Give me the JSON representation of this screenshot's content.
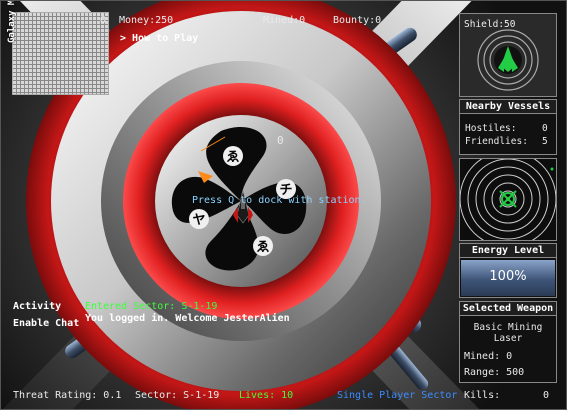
{
  "hud": {
    "galaxy_map_label": "Galaxy Map",
    "money": "Money:250",
    "mined": "Mined:0",
    "bounty": "Bounty:0",
    "how_to_play": "> How to Play",
    "dock_prompt": "Press Q to dock with station.",
    "speed_value": "0",
    "icon_o": "O",
    "activity": "Activity",
    "enable_chat": "Enable Chat",
    "chat_line1": "Entered Sector: S-1-19",
    "chat_line2": "You logged in. Welcome JesterAlien",
    "threat_rating": "Threat Rating: 0.1",
    "sector": "Sector: S-1-19",
    "lives": "Lives: 10",
    "mode": "Single Player Sector",
    "kills_label": "Kills:",
    "kills_value": "0"
  },
  "sidebar": {
    "shield": "Shield:50",
    "nearby_title": "Nearby Vessels",
    "hostiles_label": "Hostiles:",
    "hostiles_value": "0",
    "friendlies_label": "Friendlies:",
    "friendlies_value": "5",
    "energy_title": "Energy Level",
    "energy_value": "100%",
    "energy_fraction": 1.0,
    "weapon_title": "Selected Weapon",
    "weapon_name_line1": "Basic Mining",
    "weapon_name_line2": "Laser",
    "weapon_mined": "Mined: 0",
    "weapon_range": "Range: 500"
  },
  "colors": {
    "hud_green": "#3cff3c",
    "station_red": "#d01818",
    "mode_blue": "#3c8cff",
    "radar_green": "#22cc44"
  },
  "icons": {
    "station": "station-icon",
    "ship": "player-ship-icon",
    "shield_ship": "shield-ship-icon",
    "radar_target": "radar-crosshair-icon"
  }
}
